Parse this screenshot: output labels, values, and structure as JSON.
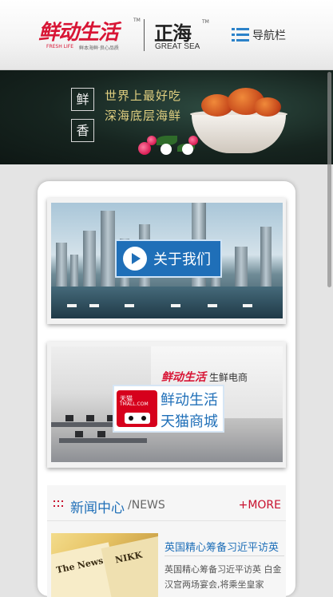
{
  "header": {
    "brand1": {
      "title": "鲜动生活",
      "tm": "TM",
      "sub_en": "FRESH LIFE",
      "sub_cn": "鲜本海鲜·良心品质"
    },
    "brand2": {
      "title": "正海",
      "tm": "TM",
      "sub": "GREAT SEA"
    },
    "nav": {
      "label": "导航栏",
      "icon": "list-menu-icon"
    }
  },
  "banner": {
    "char1": "鲜",
    "char2": "香",
    "line1": "世界上最好吃",
    "line2": "深海底层海鲜",
    "indicator_count": 2,
    "active_indicator": 0
  },
  "cards": {
    "about": {
      "label": "关于我们",
      "icon": "play-circle-icon"
    },
    "tmall": {
      "office_logo": "鲜动生活",
      "office_text": "生鲜电商",
      "logo_text": "天猫",
      "logo_sub": "TMALL.COM",
      "line1": "鲜动生活",
      "line2": "天猫商城"
    }
  },
  "news": {
    "title": "新闻中心",
    "subtitle": "/NEWS",
    "more": "+MORE",
    "icon": "grid-dots-icon",
    "item": {
      "title": "英国精心筹备习近平访英",
      "desc": "英国精心筹备习近平访英 白金汉宫两场宴会,将乘坐皇家",
      "thumb_text1": "The News",
      "thumb_text2": "NIKK"
    }
  },
  "colors": {
    "brand_red": "#d81535",
    "link_blue": "#1f6fb8",
    "accent_red": "#c8102e"
  }
}
